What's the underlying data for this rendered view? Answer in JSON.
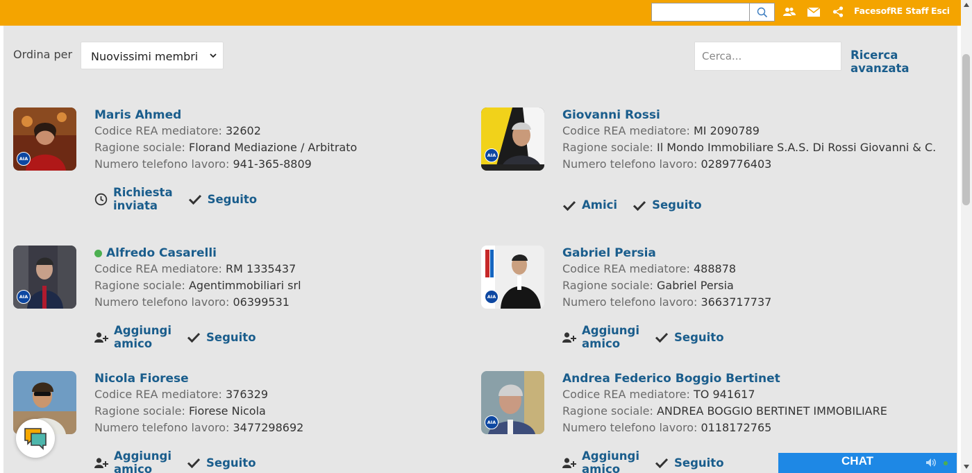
{
  "topbar": {
    "search_value": "",
    "staff_label": "FacesofRE Staff",
    "logout_label": "Esci",
    "icons": [
      "search-icon",
      "users-icon",
      "mail-icon",
      "share-icon"
    ],
    "bg_color": "#f4a400"
  },
  "toolbar": {
    "sort_label": "Ordina per",
    "sort_selected": "Nuovissimi membri",
    "search_placeholder": "Cerca...",
    "advanced_search": "Ricerca avanzata"
  },
  "labels": {
    "rea": "Codice REA mediatore:",
    "company": "Ragione sociale:",
    "phone": "Numero telefono lavoro:"
  },
  "badge_text": "AIA",
  "members": [
    {
      "name": "Maris Ahmed",
      "online": false,
      "rea": "32602",
      "company": "Florand Mediazione / Arbitrato",
      "phone": "941-365-8809",
      "actions": [
        {
          "label": "Richiesta inviata",
          "icon": "clock-icon"
        },
        {
          "label": "Seguito",
          "icon": "check-icon"
        }
      ]
    },
    {
      "name": "Giovanni Rossi",
      "online": false,
      "rea": "MI 2090789",
      "company": "Il Mondo Immobiliare S.A.S. Di Rossi Giovanni & C.",
      "phone": "0289776403",
      "actions": [
        {
          "label": "Amici",
          "icon": "check-icon"
        },
        {
          "label": "Seguito",
          "icon": "check-icon"
        }
      ]
    },
    {
      "name": "Alfredo Casarelli",
      "online": true,
      "rea": "RM 1335437",
      "company": "Agentimmobiliari srl",
      "phone": "06399531",
      "actions": [
        {
          "label": "Aggiungi amico",
          "icon": "add-user-icon"
        },
        {
          "label": "Seguito",
          "icon": "check-icon"
        }
      ]
    },
    {
      "name": "Gabriel Persia",
      "online": false,
      "rea": "488878",
      "company": "Gabriel Persia",
      "phone": "3663717737",
      "actions": [
        {
          "label": "Aggiungi amico",
          "icon": "add-user-icon"
        },
        {
          "label": "Seguito",
          "icon": "check-icon"
        }
      ]
    },
    {
      "name": "Nicola Fiorese",
      "online": false,
      "rea": "376329",
      "company": "Fiorese Nicola",
      "phone": "3477298692",
      "actions": [
        {
          "label": "Aggiungi amico",
          "icon": "add-user-icon"
        },
        {
          "label": "Seguito",
          "icon": "check-icon"
        }
      ]
    },
    {
      "name": "Andrea Federico Boggio Bertinet",
      "online": false,
      "rea": "TO 941617",
      "company": "ANDREA BOGGIO BERTINET IMMOBILIARE",
      "phone": "0118172765",
      "actions": [
        {
          "label": "Aggiungi amico",
          "icon": "add-user-icon"
        },
        {
          "label": "Seguito",
          "icon": "check-icon"
        }
      ]
    }
  ],
  "chat": {
    "label": "CHAT",
    "bar_color": "#1e88e5"
  },
  "colors": {
    "link": "#1a5d8c",
    "online": "#4caf50",
    "background": "#e6e6e6"
  }
}
